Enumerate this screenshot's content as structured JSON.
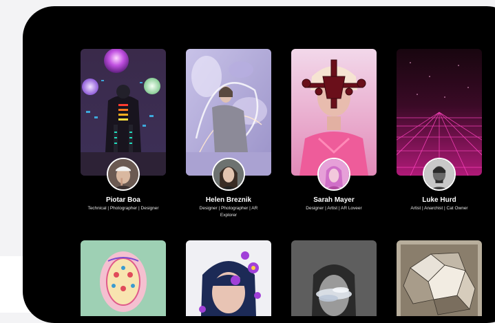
{
  "profiles": [
    {
      "name": "Piotar Boa",
      "roles": "Technical | Photographer | Designer"
    },
    {
      "name": "Helen Breznik",
      "roles": "Designer | Photographer | AR Explorer"
    },
    {
      "name": "Sarah Mayer",
      "roles": "Designer | Artist | AR Loveer"
    },
    {
      "name": "Luke Hurd",
      "roles": "Artist | Anarchist | Cat Owner"
    }
  ]
}
